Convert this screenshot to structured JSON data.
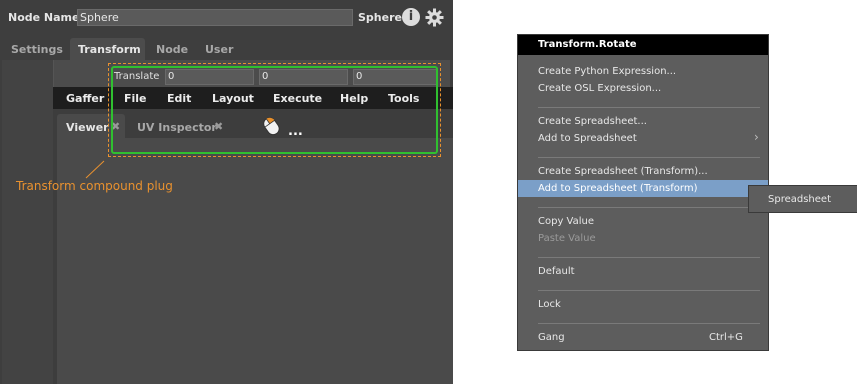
{
  "node_editor": {
    "node_name_label": "Node Name",
    "node_name_value": "Sphere",
    "node_type": "Sphere",
    "tabs": [
      "Settings",
      "Transform",
      "Node",
      "User"
    ],
    "active_tab": "Transform",
    "translate_label": "Translate",
    "translate_values": [
      "0",
      "0",
      "0"
    ]
  },
  "gaffer_window": {
    "menu": [
      "Gaffer",
      "File",
      "Edit",
      "Layout",
      "Execute",
      "Help",
      "Tools"
    ],
    "tabs": [
      "Viewer",
      "UV Inspector"
    ],
    "ellipsis": "..."
  },
  "annotation": {
    "text": "Transform compound plug",
    "color": "#e8912f",
    "highlight_color": "#30c030"
  },
  "context_menu": {
    "title": "Transform.Rotate",
    "groups": [
      [
        "Create Python Expression...",
        "Create OSL Expression..."
      ],
      [
        "Create Spreadsheet...",
        "Add to Spreadsheet"
      ],
      [
        "Create Spreadsheet (Transform)...",
        "Add to Spreadsheet (Transform)"
      ],
      [
        "Copy Value",
        "Paste Value"
      ],
      [
        "Default"
      ],
      [
        "Lock"
      ],
      [
        "Gang"
      ]
    ],
    "disabled_item": "Paste Value",
    "highlighted_item": "Add to Spreadsheet (Transform)",
    "gang_shortcut": "Ctrl+G",
    "submenu_item": "Spreadsheet",
    "highlight_color": "#7b9fc8"
  }
}
